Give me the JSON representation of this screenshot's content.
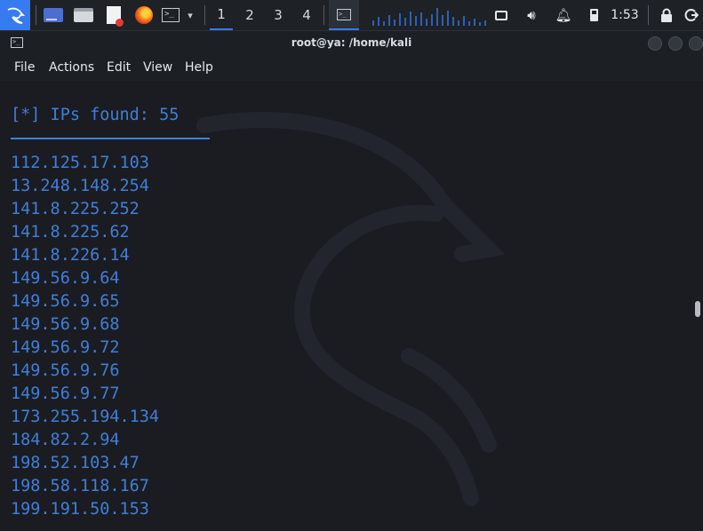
{
  "taskbar": {
    "workspaces": [
      "1",
      "2",
      "3",
      "4"
    ],
    "active_workspace": "1",
    "clock": "1:53"
  },
  "window": {
    "title": "root@ya: /home/kali",
    "menu": [
      "File",
      "Actions",
      "Edit",
      "View",
      "Help"
    ]
  },
  "terminal": {
    "header": "[*] IPs found: 55",
    "ips": [
      "112.125.17.103",
      "13.248.148.254",
      "141.8.225.252",
      "141.8.225.62",
      "141.8.226.14",
      "149.56.9.64",
      "149.56.9.65",
      "149.56.9.68",
      "149.56.9.72",
      "149.56.9.76",
      "149.56.9.77",
      "173.255.194.134",
      "184.82.2.94",
      "198.52.103.47",
      "198.58.118.167",
      "199.191.50.153"
    ]
  },
  "colors": {
    "accent": "#367bf0",
    "terminal_text": "#3f7fd8",
    "background": "#1a1c22"
  }
}
